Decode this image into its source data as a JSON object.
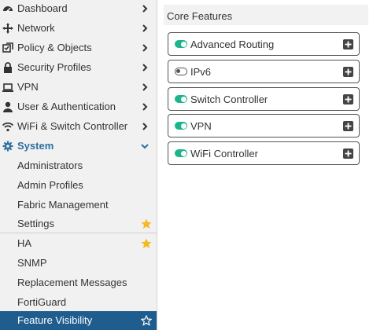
{
  "sidebar": {
    "items": [
      {
        "label": "Dashboard",
        "icon": "dashboard-icon"
      },
      {
        "label": "Network",
        "icon": "network-icon"
      },
      {
        "label": "Policy & Objects",
        "icon": "policy-icon"
      },
      {
        "label": "Security Profiles",
        "icon": "lock-icon"
      },
      {
        "label": "VPN",
        "icon": "laptop-icon"
      },
      {
        "label": "User & Authentication",
        "icon": "user-icon"
      },
      {
        "label": "WiFi & Switch Controller",
        "icon": "wifi-icon"
      },
      {
        "label": "System",
        "icon": "gear-icon"
      }
    ],
    "system_sub": [
      {
        "label": "Administrators"
      },
      {
        "label": "Admin Profiles"
      },
      {
        "label": "Fabric Management"
      },
      {
        "label": "Settings",
        "starred": true
      },
      {
        "label": "HA",
        "starred": true
      },
      {
        "label": "SNMP"
      },
      {
        "label": "Replacement Messages"
      },
      {
        "label": "FortiGuard"
      },
      {
        "label": "Feature Visibility",
        "active": true,
        "starred": false
      }
    ]
  },
  "content": {
    "section_title": "Core Features",
    "features": [
      {
        "label": "Advanced Routing",
        "enabled": true
      },
      {
        "label": "IPv6",
        "enabled": false
      },
      {
        "label": "Switch Controller",
        "enabled": true
      },
      {
        "label": "VPN",
        "enabled": true
      },
      {
        "label": "WiFi Controller",
        "enabled": true
      }
    ]
  },
  "colors": {
    "accent": "#1f5d8f",
    "system_text": "#2f6f9f",
    "toggle_on": "#1db58a",
    "star": "#f5b921"
  }
}
